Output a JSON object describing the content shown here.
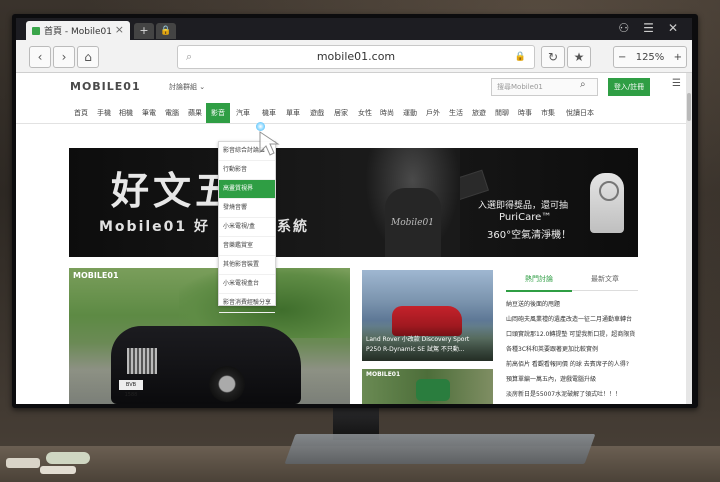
{
  "browser": {
    "tab_title": "首頁 - Mobile01",
    "url": "mobile01.com",
    "zoom": "125%",
    "zoom_minus": "−",
    "zoom_plus": "+",
    "back_icon": "back-arrow-icon",
    "forward_icon": "forward-arrow-icon",
    "home_icon": "home-icon"
  },
  "site": {
    "logo": "MOBILE01",
    "forum_menu": "討論群組 ⌄",
    "search_placeholder": "搜尋Mobile01",
    "login_label": "登入/註冊",
    "categories": [
      "首頁",
      "手機",
      "相機",
      "筆電",
      "電腦",
      "蘋果",
      "影音",
      "汽車",
      "機車",
      "單車",
      "遊戲",
      "居家",
      "女性",
      "時尚",
      "運動",
      "戶外",
      "生活",
      "旅遊",
      "閒聊",
      "時事",
      "市集",
      "悅讀日本"
    ],
    "active_category": "影音"
  },
  "dropdown": {
    "items": [
      "影音綜合討論區",
      "行動影音",
      "高畫質視界",
      "發燒音響",
      "小米電視/盒",
      "音樂鑑賞室",
      "其他影音裝置",
      "小米電視盒台",
      "影音消費經驗分享"
    ],
    "active_index": 2
  },
  "banner": {
    "big_text": "好文五機",
    "sub_text_left": "Mobile01 好",
    "sub_text_right": "系統",
    "shirt_text": "Mobile01",
    "line1": "入選即得獎品，還可抽",
    "line2": "PuriCare™",
    "line3": "360°空氣清淨機！"
  },
  "photos": {
    "main_logo": "MOBILE01",
    "main_plate": "BVB 1588",
    "side_caption_1": "Land Rover 小改款 Discovery Sport",
    "side_caption_2": "P250 R-Dynamic SE 試駕 不只動...",
    "side2_logo": "MOBILE01"
  },
  "sidebar": {
    "tab_hot": "熱門討論",
    "tab_new": "最新文章",
    "items": [
      "納豆送的後面的甩題",
      "山岡砲夫風業禮的遺產改造一征二月通勤車轉台",
      "口頭實說那12.0轉提墊 可望我新口提，超商限貨",
      "各種3C科和英要跟著更加比較實例",
      "前高佰片 看觀看報同價 的球 去賓席子的人得?",
      "預算單編一萬五內，遊戲電腦升級",
      "淡房新日是55007水泥破解了領式吐！！！",
      "錯誤運轉是要重新開啟客戶"
    ]
  }
}
